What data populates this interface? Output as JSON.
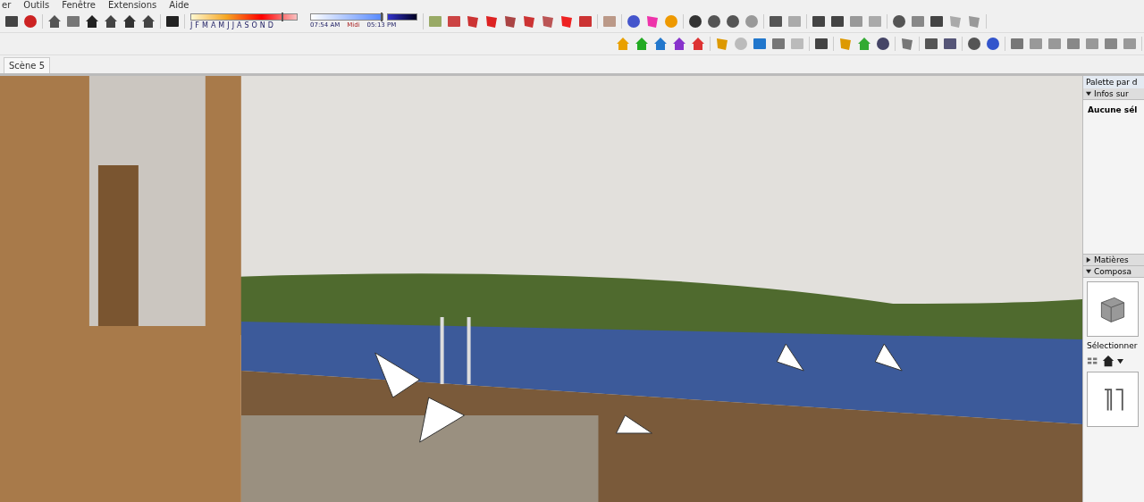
{
  "menu_bar": {
    "items": [
      "er",
      "Outils",
      "Fenêtre",
      "Extensions",
      "Aide"
    ]
  },
  "shadow_settings": {
    "months": [
      "J",
      "F",
      "M",
      "A",
      "M",
      "J",
      "J",
      "A",
      "S",
      "O",
      "N",
      "D"
    ],
    "month_slider": {
      "level": 0.86
    },
    "time_slider": {
      "level": 1
    },
    "time_start": "07:54 AM",
    "time_mid": "Midi",
    "time_end": "05:13 PM"
  },
  "scene_tabs": [
    {
      "label": "Scène 5",
      "selected": true
    }
  ],
  "tray": {
    "title": "Palette par d",
    "panels": [
      {
        "title": "Infos sur",
        "expanded": true,
        "body": "Aucune sél"
      },
      {
        "title": "Matières",
        "expanded": false
      },
      {
        "title": "Composa",
        "expanded": true,
        "select_label": "Sélectionner"
      }
    ]
  }
}
